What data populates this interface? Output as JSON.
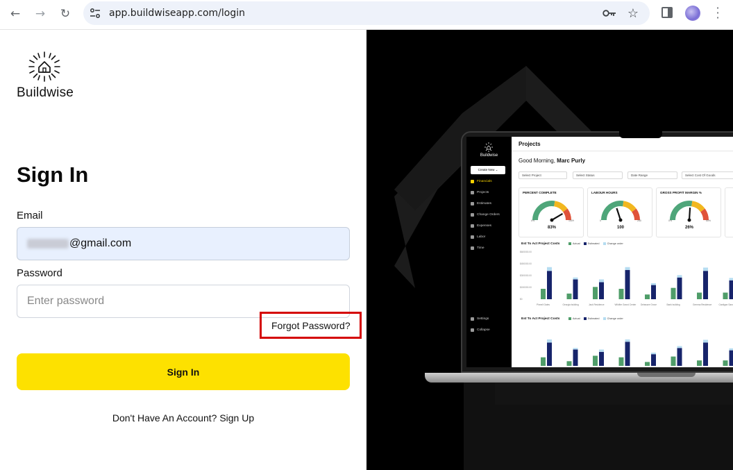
{
  "browser": {
    "url": "app.buildwiseapp.com/login"
  },
  "login": {
    "logo_text": "Buildwise",
    "heading": "Sign In",
    "email_label": "Email",
    "email_value": "@gmail.com",
    "password_label": "Password",
    "password_placeholder": "Enter password",
    "forgot_label": "Forgot Password?",
    "signin_label": "Sign In",
    "signup_label": "Don't Have An Account? Sign Up",
    "highlight_color": "#d40000",
    "button_color": "#fde100"
  },
  "promo": {
    "app_logo_text": "Buildwise",
    "create_label": "Create New",
    "sidebar": [
      "Financials",
      "Projects",
      "Estimates",
      "Change Orders",
      "Expenses",
      "Labor",
      "Time"
    ],
    "sidebar_bottom": [
      "Settings",
      "Collapse"
    ],
    "page_title": "Projects",
    "greeting_prefix": "Good Morning,",
    "greeting_name": "Marc Purly",
    "filters": [
      "Select Project",
      "Select Status",
      "Date Range",
      "Select Cost Of Goods"
    ],
    "kpis": [
      {
        "label": "PERCENT COMPLETE",
        "value": "83%",
        "fraction": 0.83,
        "min": "0%",
        "max": "100%"
      },
      {
        "label": "LABOUR HOURS",
        "value": "100",
        "fraction": 0.4,
        "min": "0",
        "max": "250"
      },
      {
        "label": "GROSS PROFIT MARGIN %",
        "value": "26%",
        "fraction": 0.52,
        "min": "0%",
        "max": "50%"
      }
    ],
    "chart1_title": "Est To Act Project Costs",
    "chart2_title": "Est To Act Project Costs",
    "legend": [
      "Actual",
      "Estimated",
      "Change order"
    ],
    "series_colors": [
      "#4f9d69",
      "#17246b",
      "#b5dcf1"
    ],
    "chart_categories": [
      "Pinnell Gates",
      "Georgia building",
      "Jack Residence",
      "Wildfire Grand Center",
      "Delaware Grove",
      "Bank building",
      "Gemma Residence",
      "Cardigan Sand Gates"
    ],
    "chart_actual": [
      0.22,
      0.12,
      0.26,
      0.22,
      0.1,
      0.24,
      0.14,
      0.14
    ],
    "chart_estimated": [
      0.6,
      0.42,
      0.36,
      0.62,
      0.3,
      0.46,
      0.6,
      0.4
    ],
    "chart_change": [
      0.08,
      0.04,
      0.06,
      0.06,
      0.04,
      0.05,
      0.07,
      0.05
    ],
    "chart_y_ticks": [
      "$600000.00",
      "$450000.00",
      "$300000.00",
      "$150000.00",
      "$0"
    ]
  }
}
